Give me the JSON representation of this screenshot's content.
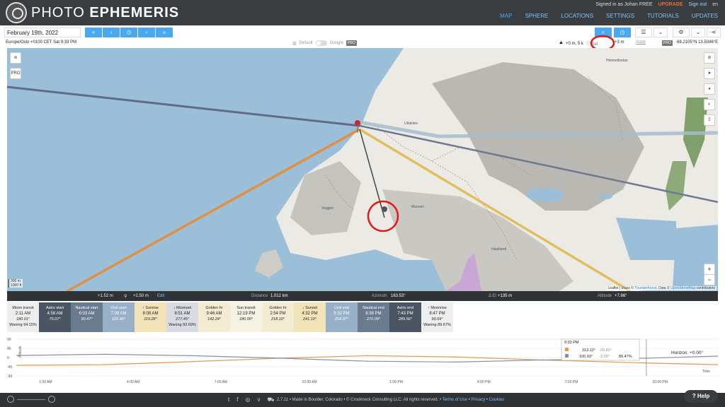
{
  "app": {
    "brand_thin": "PHOTO ",
    "brand_bold": "EPHEMERIS",
    "signed_in": "Signed in as Johan FREE",
    "upgrade": "UPGRADE",
    "sign_out": "Sign out",
    "lang": "en"
  },
  "nav": [
    "MAP",
    "SPHERE",
    "LOCATIONS",
    "SETTINGS",
    "TUTORIALS",
    "UPDATES"
  ],
  "controls": {
    "date": "February 19th, 2022",
    "timezone": "Europe/Oslo +0100 CET Sat 9:33 PM",
    "style_default": "Default",
    "style_google": "Google",
    "pro": "PRO",
    "elev_obs": "+0 m, 5 k",
    "set_label": "Set",
    "elev_tgt": "+3 m",
    "aster": "Aster",
    "coords": "68.2105°N 13.5046°E"
  },
  "map": {
    "places": [
      "Himmeltindan",
      "Uttakleiv",
      "Veggen",
      "Mannen",
      "Haukland"
    ],
    "scale_m": "300 m",
    "scale_ft": "1000 ft",
    "attribution": "Leaflet | Maps © ",
    "attr_tf": "Thunderforest",
    "attr_mid": ", Data © ",
    "attr_osm": "OpenStreetMap",
    "attr_end": " contributors",
    "zoom_in": "+",
    "zoom_out": "−",
    "layers_pro": "PRO"
  },
  "info": {
    "elev1": "+1.52 m",
    "elev2": "+2.50 m",
    "edit": "Edit",
    "distance_label": "Distance",
    "distance": "1.012 km",
    "azimuth_label": "Azimuth",
    "azimuth": "163.53°",
    "delta_label": "Δ El",
    "delta": "+135 m",
    "altitude_label": "Altitude",
    "altitude": "+7.66°"
  },
  "events": [
    {
      "name": "Moon transit",
      "time": "2:11 AM",
      "deg": "180.01°",
      "extra": "Waning 94.15%",
      "bg": "#eeeeee"
    },
    {
      "name": "Astro start",
      "time": "4:58 AM",
      "deg": "75.07°",
      "extra": "",
      "bg": "#4a5564"
    },
    {
      "name": "Nautical start",
      "time": "6:03 AM",
      "deg": "90.47°",
      "extra": "",
      "bg": "#6a7b90"
    },
    {
      "name": "Civil start",
      "time": "7:08 AM",
      "deg": "105.46°",
      "extra": "",
      "bg": "#98b0c8"
    },
    {
      "name": "↑ Sunrise",
      "time": "8:08 AM",
      "deg": "119.28°",
      "extra": "",
      "bg": "#f2e4b8"
    },
    {
      "name": "↓ Moonset",
      "time": "8:51 AM",
      "deg": "277.45°",
      "extra": "Waning 92.69%",
      "bg": "#d8dce2"
    },
    {
      "name": "Golden hr",
      "time": "9:46 AM",
      "deg": "142.24°",
      "extra": "",
      "bg": "#f4ecd2"
    },
    {
      "name": "Sun transit",
      "time": "12:19 PM",
      "deg": "180.00°",
      "extra": "",
      "bg": "#f6f2e4"
    },
    {
      "name": "Golden hr",
      "time": "2:54 PM",
      "deg": "218.10°",
      "extra": "",
      "bg": "#f4ecd2"
    },
    {
      "name": "↓ Sunset",
      "time": "4:32 PM",
      "deg": "241.10°",
      "extra": "",
      "bg": "#f2e4b8"
    },
    {
      "name": "Civil end",
      "time": "5:32 PM",
      "deg": "254.97°",
      "extra": "",
      "bg": "#98b0c8"
    },
    {
      "name": "Nautical end",
      "time": "6:38 PM",
      "deg": "270.09°",
      "extra": "",
      "bg": "#6a7b90"
    },
    {
      "name": "Astro end",
      "time": "7:43 PM",
      "deg": "285.56°",
      "extra": "",
      "bg": "#4a5564"
    },
    {
      "name": "↑ Moonrise",
      "time": "8:47 PM",
      "deg": "90.59°",
      "extra": "Waning 89.67%",
      "bg": "#eeeeee"
    }
  ],
  "chart_data": {
    "type": "line",
    "ylabel": "Altitude",
    "xlabel": "Time",
    "y_ticks": [
      "90",
      "45",
      "0",
      "-45",
      "-90"
    ],
    "x_ticks": [
      "1:00 AM",
      "4:00 AM",
      "7:00 AM",
      "10:00 AM",
      "1:00 PM",
      "4:00 PM",
      "7:00 PM",
      "10:00 PM"
    ],
    "x_tick_hours": [
      1,
      4,
      7,
      10,
      13,
      16,
      19,
      22
    ],
    "series": [
      {
        "color": "#e39a4a",
        "hours": [
          0,
          3,
          6,
          9,
          12,
          15,
          18,
          21.55,
          24
        ],
        "values": [
          -38,
          -35,
          -20,
          -3,
          9,
          3,
          -12,
          -26.81,
          -35
        ]
      },
      {
        "color": "#8492a8",
        "hours": [
          0,
          3,
          6,
          9,
          12,
          15,
          18,
          21.55,
          24
        ],
        "values": [
          10,
          16,
          9,
          -3,
          -18,
          -22,
          -12,
          -3.29,
          7
        ]
      }
    ],
    "tooltip": {
      "time": "9:33 PM",
      "sun_az": "313.12°",
      "sun_alt": "-26.81°",
      "moon_az": "100.93°",
      "moon_alt": "-3.29°",
      "phase": "89.47%"
    },
    "horizon": "Horizon: +0.00°"
  },
  "footer": {
    "text": "2.7.11 • Made in Boulder, Colorado • © Crookneck Consulting LLC. All rights reserved. • ",
    "terms": "Terms of Use",
    "privacy": "Privacy",
    "cookies": "Cookies",
    "sep": " • ",
    "help": "Help"
  },
  "colors": {
    "sun": "#e39a4a",
    "moon": "#8492a8",
    "accent": "#49a9f0"
  }
}
